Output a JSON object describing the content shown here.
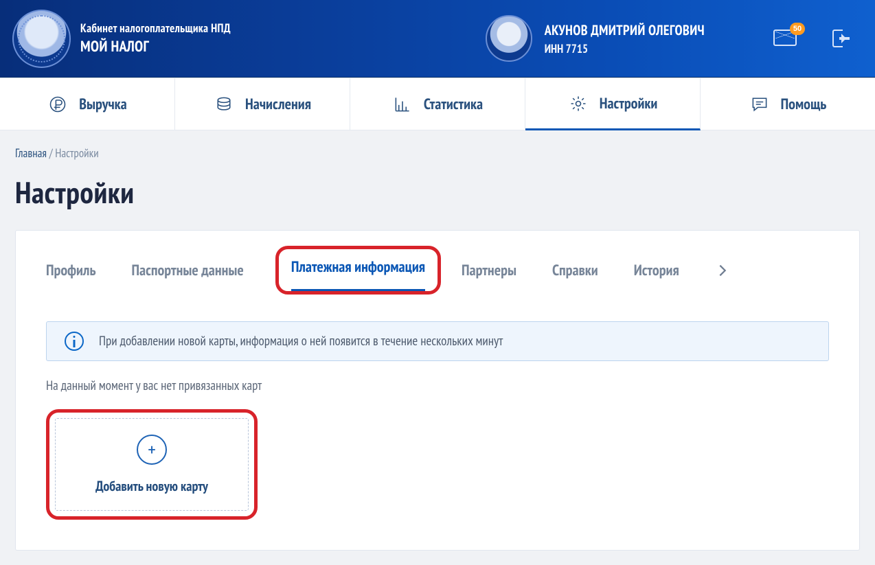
{
  "header": {
    "app_sub": "Кабинет налогоплательщика НПД",
    "app_main": "МОЙ НАЛОГ",
    "user_name": "АКУНОВ ДМИТРИЙ ОЛЕГОВИЧ",
    "user_inn": "ИНН 7715",
    "mail_badge": "50"
  },
  "nav": {
    "revenue": "Выручка",
    "charges": "Начисления",
    "stats": "Статистика",
    "settings": "Настройки",
    "help": "Помощь"
  },
  "crumbs": {
    "home": "Главная",
    "current": "Настройки"
  },
  "page_title": "Настройки",
  "subtabs": {
    "profile": "Профиль",
    "passport": "Паспортные данные",
    "payment": "Платежная информация",
    "partners": "Партнеры",
    "refs": "Справки",
    "history": "История"
  },
  "alert_text": "При добавлении новой карты, информация о ней появится в течение нескольких минут",
  "empty_text": "На данный момент у вас нет привязанных карт",
  "add_card_label": "Добавить новую карту"
}
